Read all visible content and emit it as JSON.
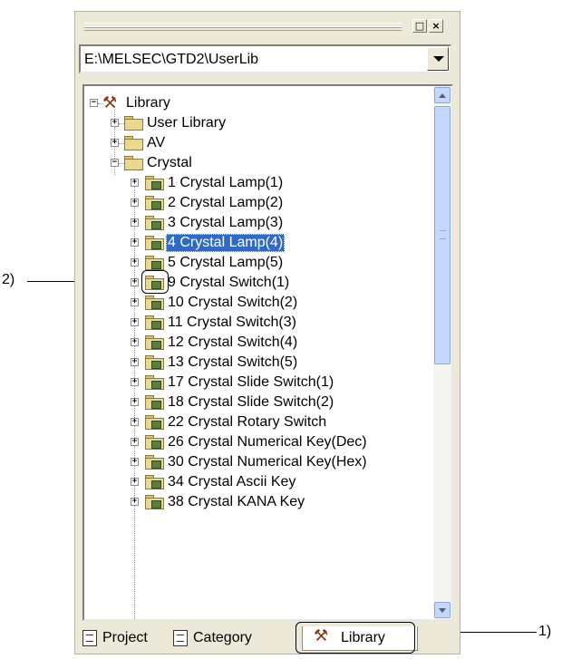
{
  "window": {
    "buttons": [
      "□",
      "×"
    ]
  },
  "path_combo": {
    "value": "E:\\MELSEC\\GTD2\\UserLib"
  },
  "tree": {
    "root": {
      "label": "Library",
      "icon": "library-tools-icon"
    },
    "folders": [
      {
        "label": "User Library",
        "expanded": false
      },
      {
        "label": "AV",
        "expanded": false
      },
      {
        "label": "Crystal",
        "expanded": true
      }
    ],
    "crystal_items": [
      {
        "label": "1 Crystal Lamp(1)",
        "selected": false
      },
      {
        "label": "2 Crystal Lamp(2)",
        "selected": false
      },
      {
        "label": "3 Crystal Lamp(3)",
        "selected": false
      },
      {
        "label": "4 Crystal Lamp(4)",
        "selected": true
      },
      {
        "label": "5 Crystal Lamp(5)",
        "selected": false
      },
      {
        "label": "9 Crystal Switch(1)",
        "selected": false
      },
      {
        "label": "10 Crystal Switch(2)",
        "selected": false
      },
      {
        "label": "11 Crystal Switch(3)",
        "selected": false
      },
      {
        "label": "12 Crystal Switch(4)",
        "selected": false
      },
      {
        "label": "13 Crystal Switch(5)",
        "selected": false
      },
      {
        "label": "17 Crystal Slide Switch(1)",
        "selected": false
      },
      {
        "label": "18 Crystal Slide Switch(2)",
        "selected": false
      },
      {
        "label": "22 Crystal Rotary Switch",
        "selected": false
      },
      {
        "label": "26 Crystal Numerical Key(Dec)",
        "selected": false
      },
      {
        "label": "30 Crystal Numerical Key(Hex)",
        "selected": false
      },
      {
        "label": "34 Crystal Ascii Key",
        "selected": false
      },
      {
        "label": "38 Crystal KANA Key",
        "selected": false
      }
    ]
  },
  "tabs": [
    {
      "label": "Project",
      "icon": "project-icon",
      "active": false
    },
    {
      "label": "Category",
      "icon": "category-icon",
      "active": false
    },
    {
      "label": "Library",
      "icon": "library-tools-icon",
      "active": true
    }
  ],
  "annotations": {
    "one": "1)",
    "two": "2)"
  },
  "colors": {
    "selection": "#316ac5",
    "panel": "#ece9d8"
  }
}
